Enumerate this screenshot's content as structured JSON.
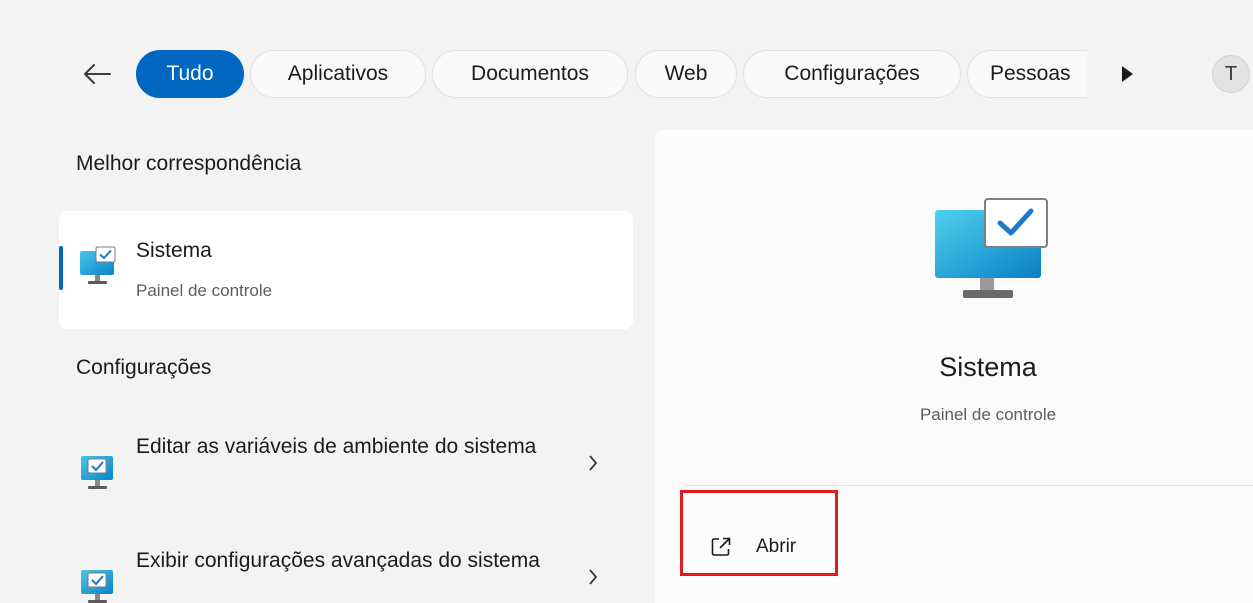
{
  "filters": {
    "back_icon": "arrow-left-icon",
    "tabs": [
      {
        "label": "Tudo",
        "active": true
      },
      {
        "label": "Aplicativos",
        "active": false
      },
      {
        "label": "Documentos",
        "active": false
      },
      {
        "label": "Web",
        "active": false
      },
      {
        "label": "Configurações",
        "active": false
      },
      {
        "label": "Pessoas",
        "active": false
      }
    ],
    "more_icon": "play-triangle-icon",
    "avatar_initial": "T"
  },
  "best_match": {
    "section_title": "Melhor correspondência",
    "name": "Sistema",
    "subtitle": "Painel de controle",
    "icon": "monitor-check-icon"
  },
  "settings": {
    "section_title": "Configurações",
    "items": [
      {
        "label": "Editar as variáveis de ambiente do sistema",
        "icon": "monitor-check-icon"
      },
      {
        "label": "Exibir configurações avançadas do sistema",
        "icon": "monitor-check-icon"
      }
    ]
  },
  "detail": {
    "name": "Sistema",
    "subtitle": "Painel de controle",
    "icon": "monitor-check-icon",
    "actions": [
      {
        "label": "Abrir",
        "icon": "open-external-icon"
      }
    ]
  },
  "colors": {
    "accent": "#0067c0",
    "highlight": "#e01b1b"
  }
}
